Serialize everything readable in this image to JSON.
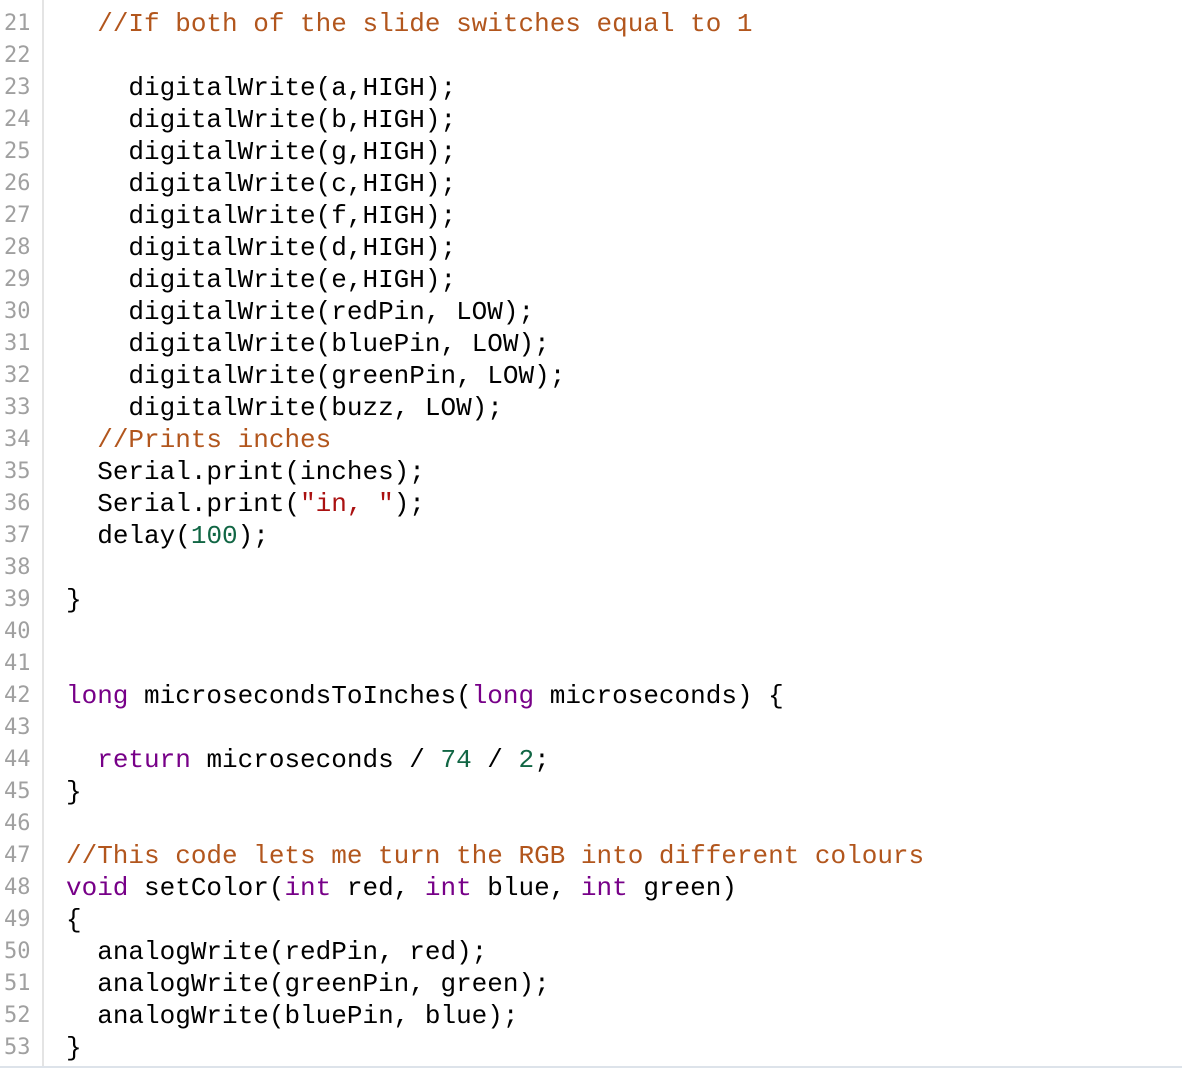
{
  "editor": {
    "colors": {
      "comment": "#b2561d",
      "keyword": "#770088",
      "number": "#116644",
      "string": "#aa1111",
      "text": "#000000",
      "line_number": "#a0a0a0"
    },
    "lines": [
      {
        "n": "21",
        "indent": "  ",
        "tokens": [
          {
            "t": "//If both of the slide switches equal to 1",
            "c": "cm"
          }
        ]
      },
      {
        "n": "22",
        "indent": "",
        "tokens": []
      },
      {
        "n": "23",
        "indent": "    ",
        "tokens": [
          {
            "t": "digitalWrite(a,HIGH);",
            "c": ""
          }
        ]
      },
      {
        "n": "24",
        "indent": "    ",
        "tokens": [
          {
            "t": "digitalWrite(b,HIGH);",
            "c": ""
          }
        ]
      },
      {
        "n": "25",
        "indent": "    ",
        "tokens": [
          {
            "t": "digitalWrite(g,HIGH);",
            "c": ""
          }
        ]
      },
      {
        "n": "26",
        "indent": "    ",
        "tokens": [
          {
            "t": "digitalWrite(c,HIGH);",
            "c": ""
          }
        ]
      },
      {
        "n": "27",
        "indent": "    ",
        "tokens": [
          {
            "t": "digitalWrite(f,HIGH);",
            "c": ""
          }
        ]
      },
      {
        "n": "28",
        "indent": "    ",
        "tokens": [
          {
            "t": "digitalWrite(d,HIGH);",
            "c": ""
          }
        ]
      },
      {
        "n": "29",
        "indent": "    ",
        "tokens": [
          {
            "t": "digitalWrite(e,HIGH);",
            "c": ""
          }
        ]
      },
      {
        "n": "30",
        "indent": "    ",
        "tokens": [
          {
            "t": "digitalWrite(redPin, LOW);",
            "c": ""
          }
        ]
      },
      {
        "n": "31",
        "indent": "    ",
        "tokens": [
          {
            "t": "digitalWrite(bluePin, LOW);",
            "c": ""
          }
        ]
      },
      {
        "n": "32",
        "indent": "    ",
        "tokens": [
          {
            "t": "digitalWrite(greenPin, LOW);",
            "c": ""
          }
        ]
      },
      {
        "n": "33",
        "indent": "    ",
        "tokens": [
          {
            "t": "digitalWrite(buzz, LOW);",
            "c": ""
          }
        ]
      },
      {
        "n": "34",
        "indent": "  ",
        "tokens": [
          {
            "t": "//Prints inches",
            "c": "cm"
          }
        ]
      },
      {
        "n": "35",
        "indent": "  ",
        "tokens": [
          {
            "t": "Serial.print(inches);",
            "c": ""
          }
        ]
      },
      {
        "n": "36",
        "indent": "  ",
        "tokens": [
          {
            "t": "Serial.print(",
            "c": ""
          },
          {
            "t": "\"in, \"",
            "c": "str"
          },
          {
            "t": ");",
            "c": ""
          }
        ]
      },
      {
        "n": "37",
        "indent": "  ",
        "tokens": [
          {
            "t": "delay(",
            "c": ""
          },
          {
            "t": "100",
            "c": "num"
          },
          {
            "t": ");",
            "c": ""
          }
        ]
      },
      {
        "n": "38",
        "indent": "",
        "tokens": []
      },
      {
        "n": "39",
        "indent": "",
        "tokens": [
          {
            "t": "}",
            "c": ""
          }
        ]
      },
      {
        "n": "40",
        "indent": "",
        "tokens": []
      },
      {
        "n": "41",
        "indent": "",
        "tokens": []
      },
      {
        "n": "42",
        "indent": "",
        "tokens": [
          {
            "t": "long",
            "c": "kw"
          },
          {
            "t": " microsecondsToInches(",
            "c": ""
          },
          {
            "t": "long",
            "c": "kw"
          },
          {
            "t": " microseconds) {",
            "c": ""
          }
        ]
      },
      {
        "n": "43",
        "indent": "",
        "tokens": []
      },
      {
        "n": "44",
        "indent": "  ",
        "tokens": [
          {
            "t": "return",
            "c": "kw"
          },
          {
            "t": " microseconds / ",
            "c": ""
          },
          {
            "t": "74",
            "c": "num"
          },
          {
            "t": " / ",
            "c": ""
          },
          {
            "t": "2",
            "c": "num"
          },
          {
            "t": ";",
            "c": ""
          }
        ]
      },
      {
        "n": "45",
        "indent": "",
        "tokens": [
          {
            "t": "}",
            "c": ""
          }
        ]
      },
      {
        "n": "46",
        "indent": "",
        "tokens": []
      },
      {
        "n": "47",
        "indent": "",
        "tokens": [
          {
            "t": "//This code lets me turn the RGB into different colours",
            "c": "cm"
          }
        ]
      },
      {
        "n": "48",
        "indent": "",
        "tokens": [
          {
            "t": "void",
            "c": "kw"
          },
          {
            "t": " setColor(",
            "c": ""
          },
          {
            "t": "int",
            "c": "kw"
          },
          {
            "t": " red, ",
            "c": ""
          },
          {
            "t": "int",
            "c": "kw"
          },
          {
            "t": " blue, ",
            "c": ""
          },
          {
            "t": "int",
            "c": "kw"
          },
          {
            "t": " green)",
            "c": ""
          }
        ]
      },
      {
        "n": "49",
        "indent": "",
        "tokens": [
          {
            "t": "{",
            "c": ""
          }
        ]
      },
      {
        "n": "50",
        "indent": "  ",
        "tokens": [
          {
            "t": "analogWrite(redPin, red);",
            "c": ""
          }
        ]
      },
      {
        "n": "51",
        "indent": "  ",
        "tokens": [
          {
            "t": "analogWrite(greenPin, green);",
            "c": ""
          }
        ]
      },
      {
        "n": "52",
        "indent": "  ",
        "tokens": [
          {
            "t": "analogWrite(bluePin, blue);",
            "c": ""
          }
        ]
      },
      {
        "n": "53",
        "indent": "",
        "tokens": [
          {
            "t": "}",
            "c": ""
          }
        ]
      }
    ]
  }
}
